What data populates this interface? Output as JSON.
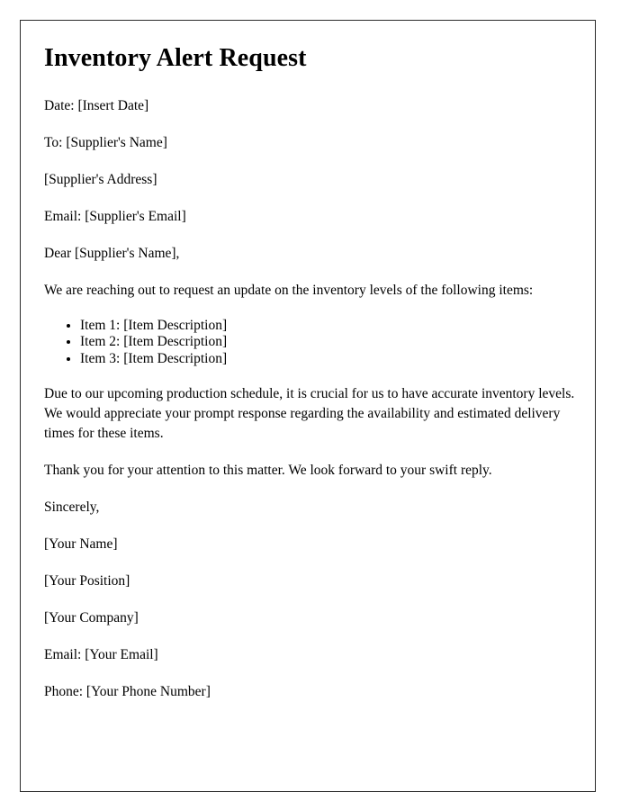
{
  "document": {
    "title": "Inventory Alert Request",
    "date_line": "Date: [Insert Date]",
    "to_line": "To: [Supplier's Name]",
    "address_line": "[Supplier's Address]",
    "email_line": "Email: [Supplier's Email]",
    "salutation": "Dear [Supplier's Name],",
    "intro_paragraph": "We are reaching out to request an update on the inventory levels of the following items:",
    "items": [
      "Item 1: [Item Description]",
      "Item 2: [Item Description]",
      "Item 3: [Item Description]"
    ],
    "body_paragraph": "Due to our upcoming production schedule, it is crucial for us to have accurate inventory levels. We would appreciate your prompt response regarding the availability and estimated delivery times for these items.",
    "closing_paragraph": "Thank you for your attention to this matter. We look forward to your swift reply.",
    "sign_off": "Sincerely,",
    "signature": {
      "name": "[Your Name]",
      "position": "[Your Position]",
      "company": "[Your Company]",
      "email": "Email: [Your Email]",
      "phone": "Phone: [Your Phone Number]"
    }
  },
  "colors": {
    "text": "#000000",
    "page_border": "#2b2b2b",
    "page_background": "#ffffff"
  }
}
